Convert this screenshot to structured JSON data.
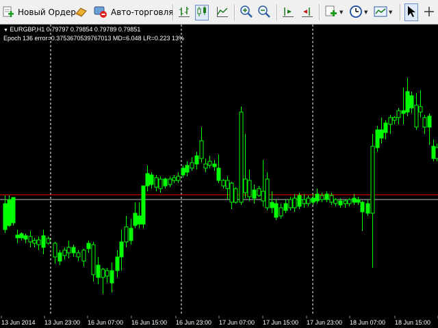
{
  "toolbar": {
    "new_order_label": "Новый Ордер",
    "auto_trading_label": "Авто-торговля",
    "icons": [
      "new-order-icon",
      "history-icon",
      "auto-trading-icon",
      "bar-chart-icon",
      "candlestick-chart-icon",
      "line-chart-icon",
      "zoom-in-icon",
      "zoom-out-icon",
      "chart-shift-icon",
      "autoscroll-icon",
      "add-indicator-icon",
      "periods-icon",
      "templates-icon",
      "cursor-icon",
      "crosshair-icon"
    ]
  },
  "chart": {
    "symbol_line": "EURGBP,H1  0.79797 0.79854 0.79789 0.79851",
    "indicator_line": "Epoch 136 error=0.3753670539767013 MD=6.048 LR=0.223 13%",
    "x_labels": [
      "13 Jun 2014",
      "13 Jun 23:00",
      "16 Jun 07:00",
      "16 Jun 15:00",
      "16 Jun 23:00",
      "17 Jun 07:00",
      "17 Jun 15:00",
      "17 Jun 23:00",
      "18 Jun 07:00",
      "18 Jun 15:00",
      "18 Jun 23:00"
    ],
    "colors": {
      "background": "#000000",
      "candle": "#00ff00",
      "bid_line": "#c0c0c0",
      "red_line": "#ff0000",
      "separator": "#ffffff"
    }
  }
}
